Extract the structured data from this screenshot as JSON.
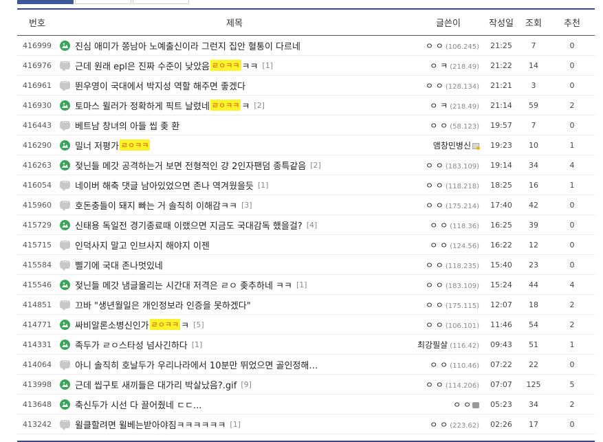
{
  "header": {
    "no": "번호",
    "title": "제목",
    "writer": "글쓴이",
    "date": "작성일",
    "views": "조회",
    "recommend": "추천"
  },
  "rows": [
    {
      "no": "416999",
      "icon": "image",
      "title": "진심 애미가 쫑남아 노예출신이라 그런지 집안 혈통이 다르네",
      "hl": "",
      "after": "",
      "comments": "",
      "writer": "ㅇ ㅇ",
      "ip": "(106.245)",
      "badge": "",
      "date": "21:25",
      "views": "7",
      "rec": "0"
    },
    {
      "no": "416976",
      "icon": "text",
      "title": "근데 원래 epl은 진짜 수준이 낮았음",
      "hl": "ㄹㅇㅋㅋ",
      "after": "ㅋㅋ",
      "comments": "[1]",
      "writer": "ㅇ ㅋ",
      "ip": "(218.49)",
      "badge": "",
      "date": "21:22",
      "views": "14",
      "rec": "0"
    },
    {
      "no": "416961",
      "icon": "text",
      "title": "뛴우영이 국대에서 박지성 역할 해주면 좋겠다",
      "hl": "",
      "after": "",
      "comments": "",
      "writer": "ㅇ ㅇ",
      "ip": "(128.134)",
      "badge": "",
      "date": "21:21",
      "views": "3",
      "rec": "0"
    },
    {
      "no": "416930",
      "icon": "image",
      "title": "토마스 뮐러가 정확하게 픽트 날렸네",
      "hl": "ㄹㅇㅋㅋ",
      "after": "ㅋ",
      "comments": "[2]",
      "writer": "ㅇ ㅋ",
      "ip": "(218.49)",
      "badge": "",
      "date": "21:14",
      "views": "59",
      "rec": "2"
    },
    {
      "no": "416443",
      "icon": "text",
      "title": "베트남 창녀의 아들 씹 좆 환",
      "hl": "",
      "after": "",
      "comments": "",
      "writer": "ㅇ ㅇ",
      "ip": "(58.123)",
      "badge": "",
      "date": "19:57",
      "views": "7",
      "rec": "0"
    },
    {
      "no": "416290",
      "icon": "image",
      "title": "밀너 저평가",
      "hl": "ㄹㅇㅋㅋ",
      "after": "",
      "comments": "",
      "writer": "앰창민병신",
      "ip": "",
      "badge": "gold",
      "date": "19:23",
      "views": "10",
      "rec": "1"
    },
    {
      "no": "416263",
      "icon": "image",
      "title": "젖닌들 메갓 공격하는거 보면 전형적인 걍 2인자팬덤 종특같음",
      "hl": "",
      "after": "",
      "comments": "[2]",
      "writer": "ㅇ ㅇ",
      "ip": "(183.109)",
      "badge": "",
      "date": "19:14",
      "views": "34",
      "rec": "4"
    },
    {
      "no": "416054",
      "icon": "text",
      "title": "네이버 해축 댓글 남아있었으면 존나 역겨웠을듯",
      "hl": "",
      "after": "",
      "comments": "[1]",
      "writer": "ㅇ ㅇ",
      "ip": "(118.218)",
      "badge": "",
      "date": "18:25",
      "views": "16",
      "rec": "1"
    },
    {
      "no": "415960",
      "icon": "text",
      "title": "호돈충들이 돼지 빠는 거 솔직히 이해감ㅋㅋ",
      "hl": "",
      "after": "",
      "comments": "[3]",
      "writer": "ㅇ ㅇ",
      "ip": "(175.214)",
      "badge": "",
      "date": "17:40",
      "views": "42",
      "rec": "0"
    },
    {
      "no": "415729",
      "icon": "image",
      "title": "신태용 독일전 경기종료때 이랬으면 지금도 국대감독 했을걸?",
      "hl": "",
      "after": "",
      "comments": "[4]",
      "writer": "ㅇ ㅇ",
      "ip": "(118.36)",
      "badge": "",
      "date": "16:25",
      "views": "39",
      "rec": "0"
    },
    {
      "no": "415715",
      "icon": "text",
      "title": "인덕사지 말고 인브사지 해야지 이젠",
      "hl": "",
      "after": "",
      "comments": "",
      "writer": "ㅇ ㅇ",
      "ip": "(124.56)",
      "badge": "",
      "date": "16:22",
      "views": "12",
      "rec": "0"
    },
    {
      "no": "415584",
      "icon": "text",
      "title": "삘기에 국대 존나멋있네",
      "hl": "",
      "after": "",
      "comments": "",
      "writer": "ㅇ ㅇ",
      "ip": "(118.235)",
      "badge": "",
      "date": "15:40",
      "views": "23",
      "rec": "0"
    },
    {
      "no": "415546",
      "icon": "image",
      "title": "젖닌들 메갓 냄글올리는 시간대 저격은 ㄹㅇ 좆추하네 ㅋㅋ",
      "hl": "",
      "after": "",
      "comments": "[1]",
      "writer": "ㅇ ㅇ",
      "ip": "(183.109)",
      "badge": "",
      "date": "15:24",
      "views": "44",
      "rec": "4"
    },
    {
      "no": "414851",
      "icon": "text",
      "title": "끄바 \"생년월일은 개인정보라 인증을 못하겠다\"",
      "hl": "",
      "after": "",
      "comments": "",
      "writer": "ㅇ ㅇ",
      "ip": "(175.115)",
      "badge": "",
      "date": "12:07",
      "views": "18",
      "rec": "2"
    },
    {
      "no": "414771",
      "icon": "image",
      "title": "싸비알론소병신인가",
      "hl": "ㄹㅇㅋㅋ",
      "after": "ㅋ",
      "comments": "[5]",
      "writer": "ㅇ ㅇ",
      "ip": "(106.101)",
      "badge": "",
      "date": "11:46",
      "views": "54",
      "rec": "2"
    },
    {
      "no": "414331",
      "icon": "image",
      "title": "족두가 ㄹㅇ스타성 넘사긴하다",
      "hl": "",
      "after": "",
      "comments": "[1]",
      "writer": "최강필살",
      "ip": "(116.42)",
      "badge": "",
      "date": "09:43",
      "views": "51",
      "rec": "1"
    },
    {
      "no": "414064",
      "icon": "text",
      "title": "아니 솔직히 호날두가 우리나라에서 10분만 뛰었으면 골인정해…",
      "hl": "",
      "after": "",
      "comments": "",
      "writer": "ㅇ ㅇ",
      "ip": "(110.46)",
      "badge": "",
      "date": "07:22",
      "views": "22",
      "rec": "0"
    },
    {
      "no": "413998",
      "icon": "image",
      "title": "근데 씹구토 새끼들은 대가리 박살났음?.gif",
      "hl": "",
      "after": "",
      "comments": "[9]",
      "writer": "ㅇ ㅇ",
      "ip": "(114.206)",
      "badge": "",
      "date": "07:07",
      "views": "125",
      "rec": "5"
    },
    {
      "no": "413648",
      "icon": "image",
      "title": "축신두가 시선 다 끌어줬네 ㄷㄷ...",
      "hl": "",
      "after": "",
      "comments": "",
      "writer": "ㅇ ㅇ",
      "ip": "",
      "badge": "gray",
      "date": "05:23",
      "views": "34",
      "rec": "2"
    },
    {
      "no": "413242",
      "icon": "text",
      "title": "윌클할려면 윌베는받아야짐ㅋㅋㅋㅋㅋㅋ",
      "hl": "",
      "after": "",
      "comments": "[1]",
      "writer": "ㅇ ㅇ",
      "ip": "(223.62)",
      "badge": "",
      "date": "02:26",
      "views": "17",
      "rec": "0"
    }
  ]
}
